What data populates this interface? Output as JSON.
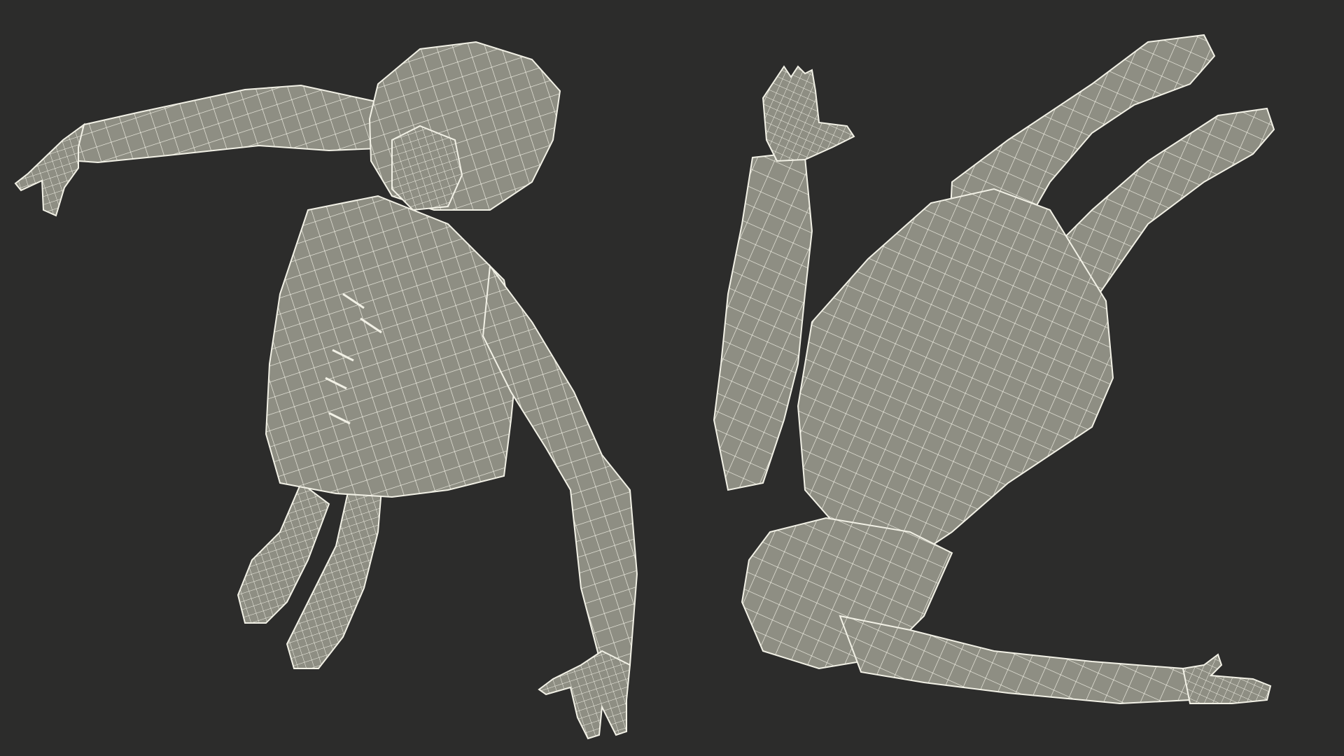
{
  "scene": {
    "background": "#2c2c2b",
    "mesh_fill": "#8e8e83",
    "mesh_fill_dark": "#6e6e64",
    "wire_color": "#f2f1e6",
    "shadow_color": "#1c1c1b"
  },
  "models": [
    {
      "name": "figure-top-view-left",
      "view": "top",
      "pose": "arms-outstretched"
    },
    {
      "name": "figure-bottom-view-right",
      "view": "bottom",
      "pose": "arms-outstretched"
    }
  ]
}
